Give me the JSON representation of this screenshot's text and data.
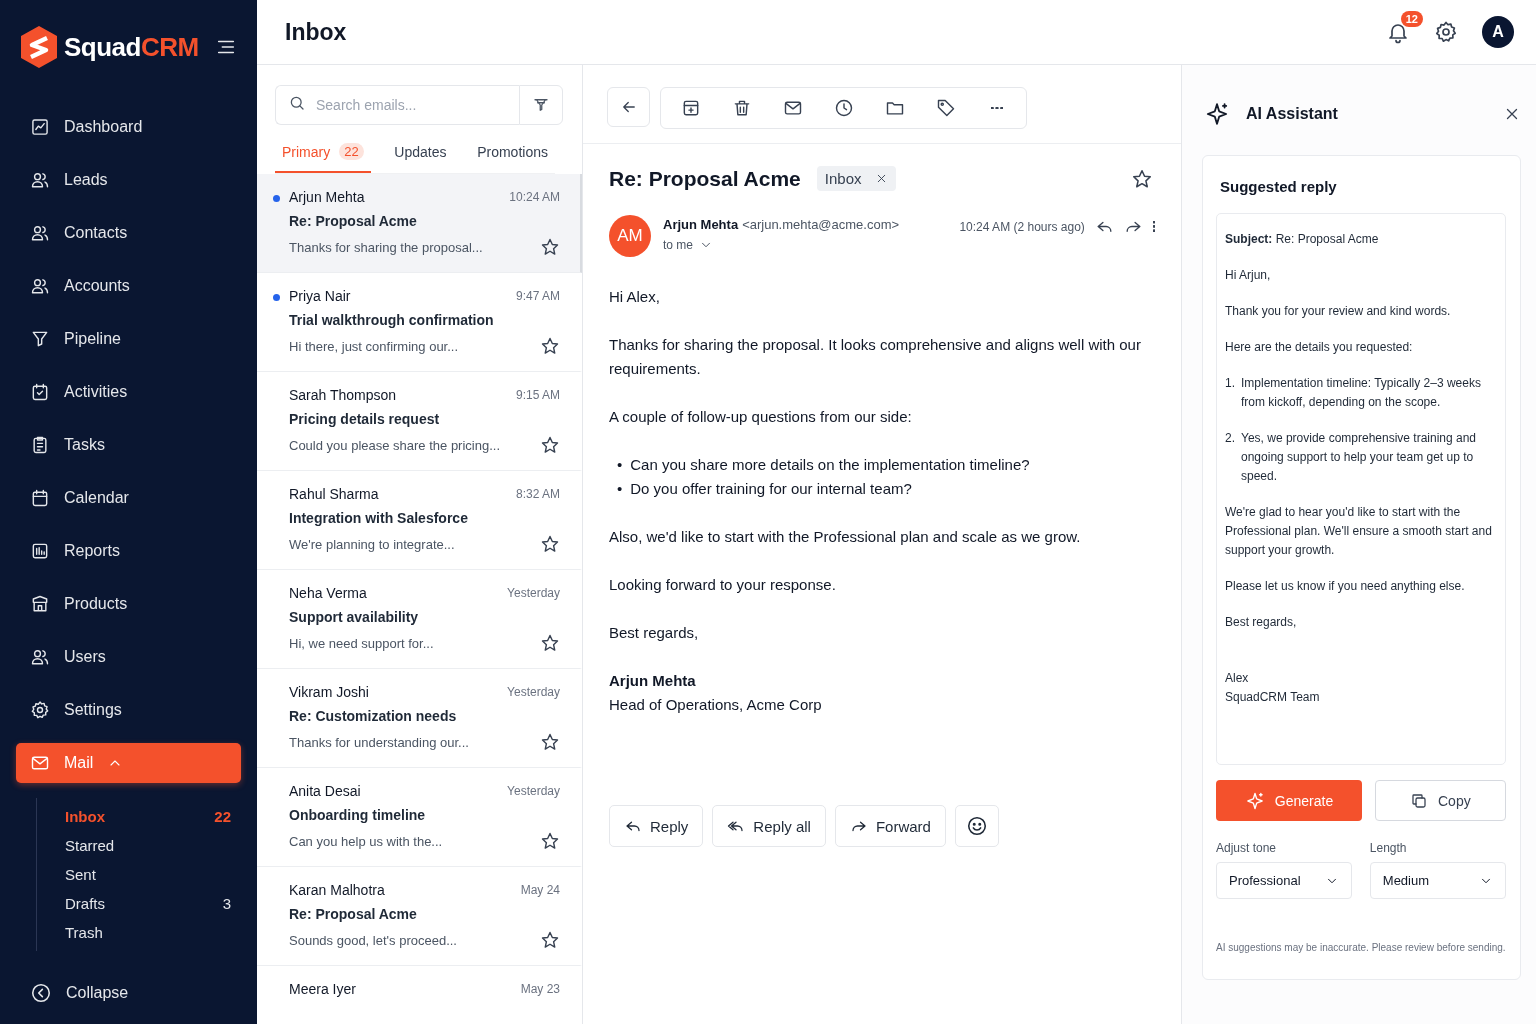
{
  "sidebar": {
    "logo": "Squad**CRM**",
    "nav": [
      {
        "label": "Dashboard",
        "selected": false
      },
      {
        "label": "Leads",
        "selected": false
      },
      {
        "label": "Contacts",
        "selected": false
      },
      {
        "label": "Accounts",
        "selected": false
      },
      {
        "label": "Pipeline",
        "selected": false
      },
      {
        "label": "Activities",
        "selected": false
      },
      {
        "label": "Tasks",
        "selected": false
      },
      {
        "label": "Calendar",
        "selected": false
      },
      {
        "label": "Reports",
        "selected": false
      },
      {
        "label": "Products",
        "selected": false
      },
      {
        "label": "Users",
        "selected": false
      },
      {
        "label": "Settings",
        "selected": false
      },
      {
        "label": "Mail",
        "selected": true,
        "expanded": true,
        "children": [
          {
            "label": "Inbox",
            "count": "22",
            "selected": true
          },
          {
            "label": "Starred",
            "selected": false
          },
          {
            "label": "Sent",
            "selected": false
          },
          {
            "label": "Drafts",
            "count": "3",
            "selected": false
          },
          {
            "label": "Trash",
            "selected": false
          }
        ]
      }
    ],
    "collapse": "Collapse"
  },
  "header": {
    "title": "Inbox",
    "notifications": "12",
    "avatar": "A"
  },
  "list": {
    "search": {
      "placeholder": "Search emails..."
    },
    "tabs": [
      {
        "label": "Primary",
        "count": "22",
        "selected": true
      },
      {
        "label": "Updates",
        "selected": false
      },
      {
        "label": "Promotions",
        "selected": false
      }
    ],
    "emails": [
      {
        "sender": "Arjun Mehta",
        "time": "10:24 AM",
        "subject": "Re: Proposal Acme",
        "preview": "Thanks for sharing the proposal...",
        "unread": true,
        "selected": true,
        "starred": false
      },
      {
        "sender": "Priya Nair",
        "time": "9:47 AM",
        "subject": "Trial walkthrough confirmation",
        "preview": "Hi there, just confirming our...",
        "unread": true,
        "selected": false,
        "starred": false
      },
      {
        "sender": "Sarah Thompson",
        "time": "9:15 AM",
        "subject": "Pricing details request",
        "preview": "Could you please share the pricing...",
        "unread": false,
        "selected": false,
        "starred": false
      },
      {
        "sender": "Rahul Sharma",
        "time": "8:32 AM",
        "subject": "Integration with Salesforce",
        "preview": "We're planning to integrate...",
        "unread": false,
        "selected": false,
        "starred": false
      },
      {
        "sender": "Neha Verma",
        "time": "Yesterday",
        "subject": "Support availability",
        "preview": "Hi, we need support for...",
        "unread": false,
        "selected": false,
        "starred": false
      },
      {
        "sender": "Vikram Joshi",
        "time": "Yesterday",
        "subject": "Re: Customization needs",
        "preview": "Thanks for understanding our...",
        "unread": false,
        "selected": false,
        "starred": false
      },
      {
        "sender": "Anita Desai",
        "time": "Yesterday",
        "subject": "Onboarding timeline",
        "preview": "Can you help us with the...",
        "unread": false,
        "selected": false,
        "starred": false
      },
      {
        "sender": "Karan Malhotra",
        "time": "May 24",
        "subject": "Re: Proposal Acme",
        "preview": "Sounds good, let's proceed...",
        "unread": false,
        "selected": false,
        "starred": false
      },
      {
        "sender": "Meera Iyer",
        "time": "May 23",
        "unread": false,
        "selected": false
      }
    ]
  },
  "message": {
    "subject": "Re: Proposal Acme",
    "label": "Inbox",
    "starred": false,
    "avatar": "AM",
    "sender": "Arjun Mehta",
    "email": "<arjun.mehta@acme.com>",
    "time": "10:24 AM (2 hours ago)",
    "recipient": "to me",
    "body": [
      {
        "kind": "text",
        "text": "Hi Alex,"
      },
      {
        "kind": "text",
        "text": "Thanks for sharing the proposal. It looks comprehensive and aligns well with our requirements."
      },
      {
        "kind": "text",
        "text": "A couple of follow-up questions from our side:"
      },
      {
        "kind": "bullets",
        "marker": "•",
        "items": [
          "Can you share more details on the implementation timeline?",
          "Do you offer training for our internal team?"
        ]
      },
      {
        "kind": "text",
        "text": "Also, we'd like to start with the Professional plan and scale as we grow."
      },
      {
        "kind": "text",
        "text": "Looking forward to your response."
      },
      {
        "kind": "text",
        "text": "Best regards,"
      },
      {
        "kind": "signature",
        "name": "Arjun Mehta",
        "title": "Head of Operations, Acme Corp"
      }
    ],
    "actions": [
      "Reply",
      "Reply all",
      "Forward"
    ]
  },
  "assistant": {
    "title": "AI Assistant",
    "heading": "Suggested reply",
    "reply": [
      {
        "kind": "text",
        "text": "**Subject:** Re: Proposal Acme"
      },
      {
        "kind": "text",
        "text": "Hi Arjun,"
      },
      {
        "kind": "text",
        "text": "Thank you for your review and kind words."
      },
      {
        "kind": "text",
        "text": "Here are the details you requested:"
      },
      {
        "kind": "numbered",
        "number": "1.",
        "text": "Implementation timeline: Typically 2–3 weeks from kickoff, depending on the scope."
      },
      {
        "kind": "numbered",
        "number": "2.",
        "text": "Yes, we provide comprehensive training and ongoing support to help your team get up to speed."
      },
      {
        "kind": "text",
        "text": "We're glad to hear you'd like to start with the Professional plan. We'll ensure a smooth start and support your growth."
      },
      {
        "kind": "text",
        "text": "Please let us know if you need anything else."
      },
      {
        "kind": "text",
        "text": "Best regards,"
      },
      {
        "kind": "lines",
        "lines": [
          "Alex",
          "SquadCRM Team"
        ]
      }
    ],
    "generate": "Generate",
    "copy": "Copy",
    "tone": {
      "label": "Adjust tone",
      "value": "Professional"
    },
    "length": {
      "label": "Length",
      "value": "Medium"
    },
    "disclaimer": "AI suggestions may be inaccurate. Please review before sending."
  }
}
